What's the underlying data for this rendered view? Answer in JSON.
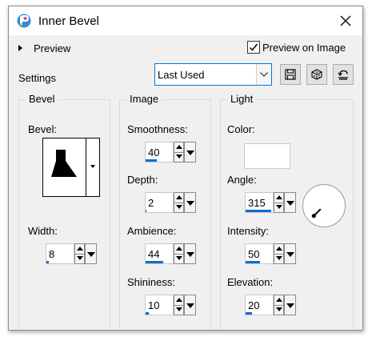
{
  "window": {
    "title": "Inner Bevel",
    "close_icon": "close-icon",
    "app_icon": "paintshop-logo-icon"
  },
  "preview": {
    "label": "Preview",
    "expanded": false
  },
  "preview_on_image": {
    "label": "Preview on Image",
    "checked": true
  },
  "settings": {
    "label": "Settings",
    "preset_value": "Last Used",
    "toolbar_icons": [
      "save-preset-icon",
      "randomize-dice-icon",
      "reset-icon"
    ]
  },
  "bevel_group": {
    "title": "Bevel",
    "bevel_label": "Bevel:",
    "width_label": "Width:",
    "width_value": "8",
    "width_fraction": 0.08
  },
  "image_group": {
    "title": "Image",
    "smoothness_label": "Smoothness:",
    "smoothness_value": "40",
    "smoothness_fraction": 0.4,
    "depth_label": "Depth:",
    "depth_value": "2",
    "depth_fraction": 0.04,
    "ambience_label": "Ambience:",
    "ambience_value": "44",
    "ambience_fraction": 0.6,
    "shininess_label": "Shininess:",
    "shininess_value": "10",
    "shininess_fraction": 0.1
  },
  "light_group": {
    "title": "Light",
    "color_label": "Color:",
    "color_value": "#ffffff",
    "angle_label": "Angle:",
    "angle_value": "315",
    "angle_fraction": 0.875,
    "intensity_label": "Intensity:",
    "intensity_value": "50",
    "intensity_fraction": 0.5,
    "elevation_label": "Elevation:",
    "elevation_value": "20",
    "elevation_fraction": 0.22
  },
  "colors": {
    "accent": "#0078d7",
    "progress": "#0a6fcf",
    "panel": "#f0f0f0"
  }
}
